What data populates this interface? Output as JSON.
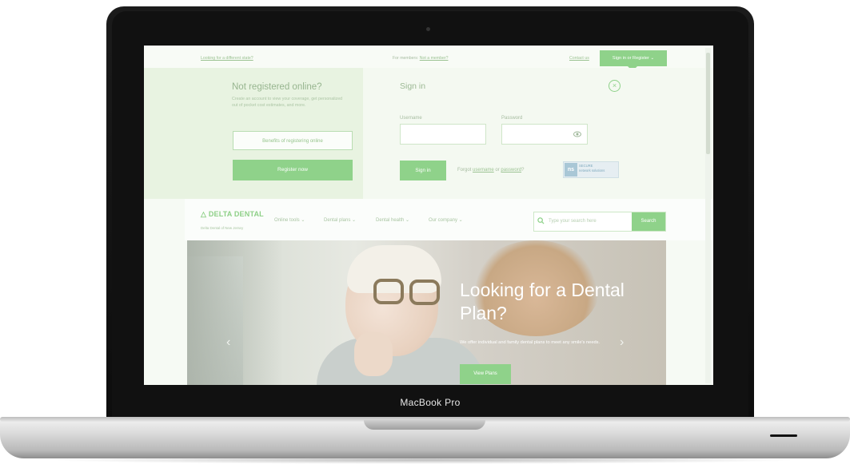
{
  "device": {
    "brand_label": "MacBook Pro"
  },
  "topbar": {
    "left_link": "Looking for a different state?",
    "members_prefix": "For members: ",
    "members_link": "Not a member?",
    "contact_link": "Contact us",
    "signin_register": "Sign in or Register"
  },
  "register_panel": {
    "title": "Not registered online?",
    "description": "Create an account to view your coverage, get personalized out of pocket cost estimates, and more.",
    "benefits_button": "Benefits of registering online",
    "register_button": "Register now"
  },
  "signin_panel": {
    "title": "Sign in",
    "username_label": "Username",
    "password_label": "Password",
    "signin_button": "Sign in",
    "forgot_prefix": "Forgot ",
    "forgot_username": "username",
    "forgot_or": " or ",
    "forgot_password": "password",
    "forgot_suffix": "?",
    "secure_badge_text_1": "SECURE",
    "secure_badge_text_2": "network solutions"
  },
  "navbar": {
    "logo": "DELTA DENTAL",
    "logo_sub": "Delta Dental of New Jersey",
    "items": [
      {
        "label": "Online tools ⌄"
      },
      {
        "label": "Dental plans ⌄"
      },
      {
        "label": "Dental health ⌄"
      },
      {
        "label": "Our company ⌄"
      }
    ],
    "search_placeholder": "Type your search here",
    "search_button": "Search"
  },
  "hero": {
    "title": "Looking for a Dental Plan?",
    "subtitle": "We offer individual and family dental plans to meet any smile's needs.",
    "button": "View Plans",
    "prev_arrow": "‹",
    "next_arrow": "›"
  },
  "colors": {
    "accent": "#8fd28a",
    "panel_left": "#e8f3e1",
    "panel_right": "#f4f9f1"
  }
}
